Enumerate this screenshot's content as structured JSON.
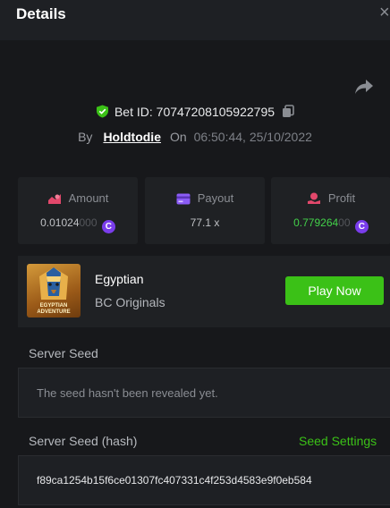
{
  "header": {
    "title": "Details",
    "close_glyph": "×"
  },
  "bet": {
    "label": "Bet ID: 70747208105922795",
    "by_label": "By",
    "user": "Holdtodie",
    "on_label": "On",
    "time": "06:50:44, 25/10/2022"
  },
  "stats": {
    "amount": {
      "label": "Amount",
      "value_main": "0.01024",
      "value_dim": "000"
    },
    "payout": {
      "label": "Payout",
      "value": "77.1 x"
    },
    "profit": {
      "label": "Profit",
      "value_main": "0.779264",
      "value_dim": "00"
    },
    "coin_glyph": "C"
  },
  "game": {
    "thumbnail_text": "EGYPTIAN ADVENTURE",
    "name": "Egyptian",
    "provider": "BC Originals",
    "play_label": "Play Now"
  },
  "server_seed": {
    "label": "Server Seed",
    "value": "The seed hasn't been revealed yet."
  },
  "server_seed_hash": {
    "label": "Server Seed (hash)",
    "settings_label": "Seed Settings",
    "value": "f89ca1254b15f6ce01307fc407331c4f253d4583e9f0eb584"
  },
  "colors": {
    "accent_green": "#3bc117",
    "profit_green": "#43d14a",
    "coin_purple": "#7a3dec",
    "amount_icon": "#e2486b",
    "payout_icon": "#8b5cf6",
    "profit_icon": "#e2486b"
  },
  "icons": [
    "close-icon",
    "share-icon",
    "verified-shield-icon",
    "copy-icon",
    "amount-icon",
    "payout-icon",
    "profit-icon",
    "coin-icon"
  ]
}
